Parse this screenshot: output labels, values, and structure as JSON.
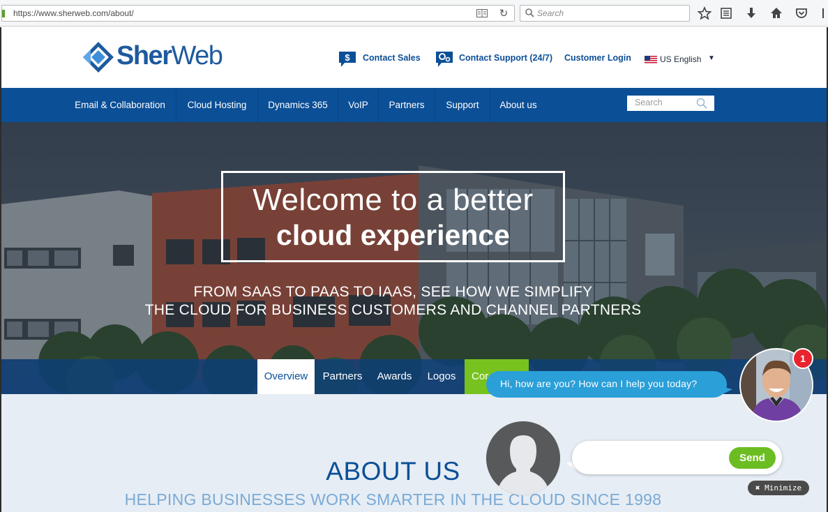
{
  "browser": {
    "url": "https://www.sherweb.com/about/",
    "search_placeholder": "Search"
  },
  "header": {
    "logo_part1": "Sher",
    "logo_part2": "Web",
    "contact_sales": "Contact Sales",
    "contact_support": "Contact Support (24/7)",
    "customer_login": "Customer Login",
    "language": "US English"
  },
  "nav": {
    "items": [
      {
        "label": "Email & Collaboration"
      },
      {
        "label": "Cloud Hosting"
      },
      {
        "label": "Dynamics 365"
      },
      {
        "label": "VoIP"
      },
      {
        "label": "Partners"
      },
      {
        "label": "Support"
      },
      {
        "label": "About us"
      }
    ],
    "search_placeholder": "Search"
  },
  "hero": {
    "line1": "Welcome to a better",
    "line2": "cloud experience",
    "sub1": "FROM SAAS TO PAAS TO IAAS, SEE HOW WE SIMPLIFY",
    "sub2": "THE CLOUD FOR BUSINESS CUSTOMERS AND CHANNEL PARTNERS"
  },
  "subtabs": {
    "items": [
      {
        "label": "Overview"
      },
      {
        "label": "Partners"
      },
      {
        "label": "Awards"
      },
      {
        "label": "Logos"
      },
      {
        "label": "Cor"
      }
    ]
  },
  "about": {
    "title": "ABOUT US",
    "subtitle": "HELPING BUSINESSES WORK SMARTER IN THE CLOUD SINCE 1998"
  },
  "chat": {
    "greeting": "Hi, how are you? How can I help you today?",
    "notification_count": "1",
    "send_label": "Send",
    "minimize_label": "✖ Minimize"
  },
  "colors": {
    "brand_blue": "#0b4f96",
    "chat_blue": "#2a9fd8",
    "contact_green": "#78c21f",
    "send_green": "#6cbd22",
    "badge_red": "#e8242f"
  }
}
